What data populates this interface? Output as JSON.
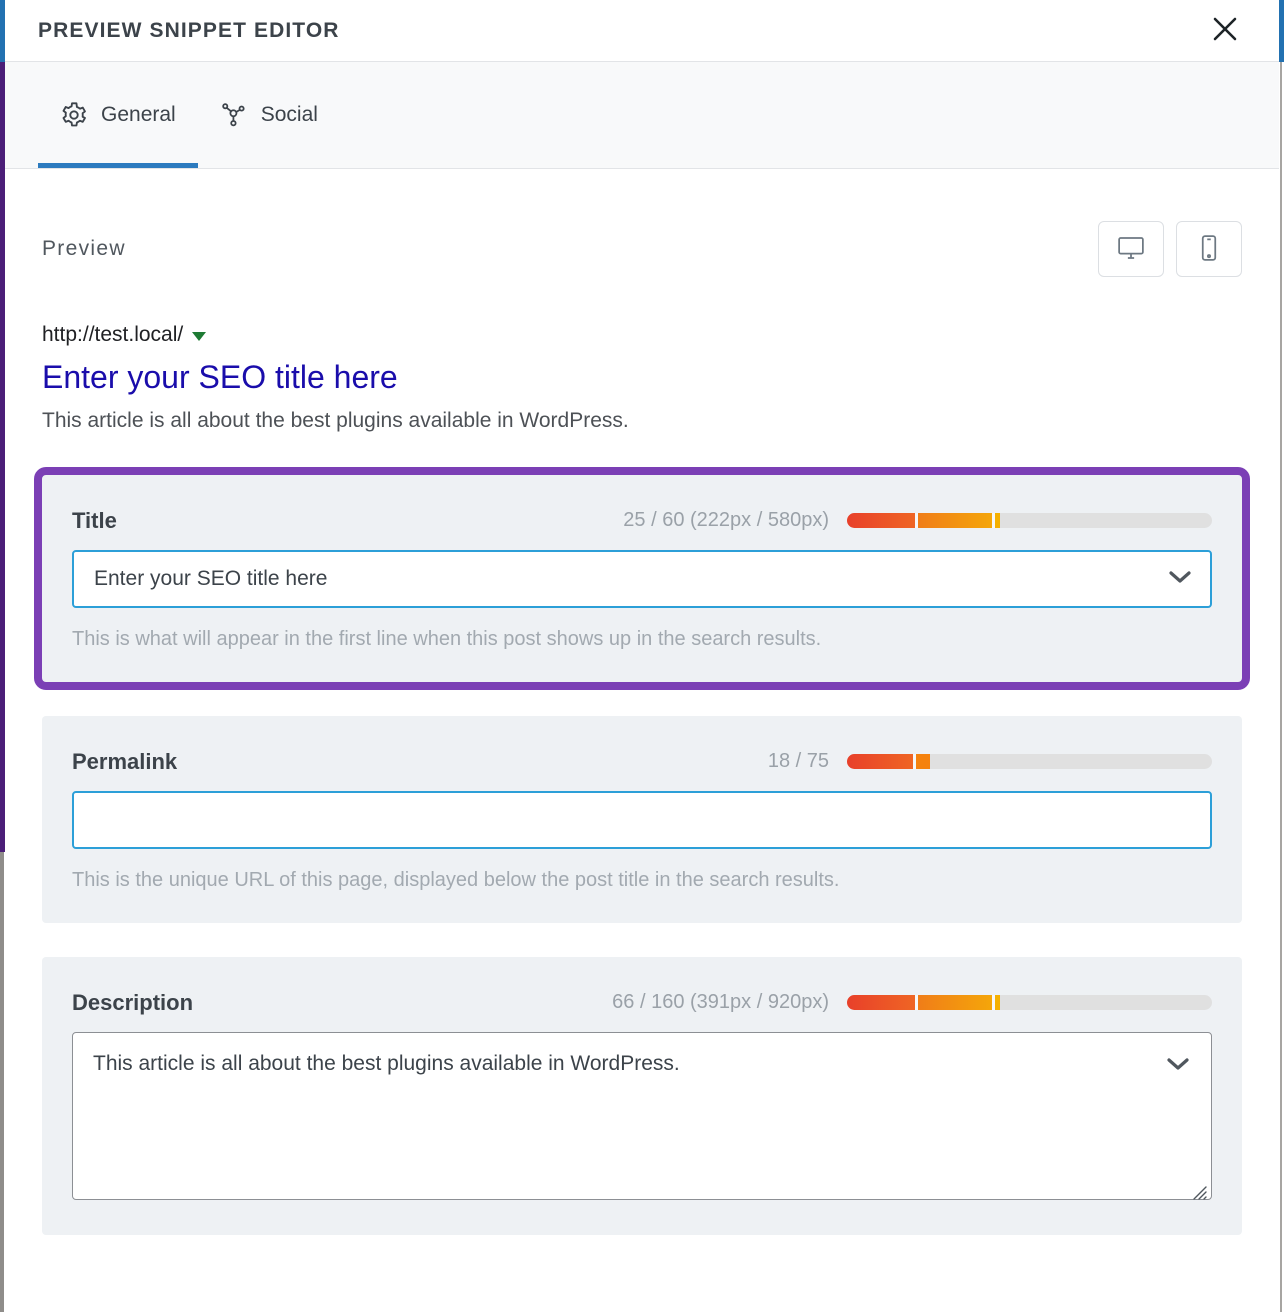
{
  "header": {
    "title": "PREVIEW SNIPPET EDITOR",
    "close_icon": "close-icon"
  },
  "tabs": [
    {
      "label": "General",
      "icon": "gear-icon",
      "active": true
    },
    {
      "label": "Social",
      "icon": "share-nodes-icon",
      "active": false
    }
  ],
  "preview": {
    "label": "Preview",
    "devices": [
      {
        "name": "desktop",
        "icon": "desktop-monitor-icon",
        "active": true
      },
      {
        "name": "mobile",
        "icon": "mobile-phone-icon",
        "active": false
      }
    ],
    "serp": {
      "url": "http://test.local/",
      "caret_icon": "caret-down-icon",
      "title": "Enter your SEO title here",
      "description": "This article is all about the best plugins available in WordPress."
    }
  },
  "fields": [
    {
      "key": "title",
      "label": "Title",
      "counter": "25 / 60 (222px / 580px)",
      "value": "Enter your SEO title here",
      "help": "This is what will appear in the first line when this post shows up in the search results.",
      "highlighted": true,
      "focused": true,
      "has_chevron": true,
      "type": "input",
      "meter": {
        "segments": [
          {
            "width_pct": 18.5,
            "from": "#e8402a",
            "to": "#ef6524"
          },
          {
            "width_pct": 20.5,
            "from": "#f07d18",
            "to": "#f5a60a"
          },
          {
            "width_pct": 1.2,
            "from": "#f5b000",
            "to": "#f5b000"
          }
        ],
        "track_color": "#e0e0e0"
      }
    },
    {
      "key": "permalink",
      "label": "Permalink",
      "counter": "18 / 75",
      "value": "",
      "help": "This is the unique URL of this page, displayed below the post title in the search results.",
      "highlighted": false,
      "focused": true,
      "has_chevron": false,
      "type": "input",
      "meter": {
        "segments": [
          {
            "width_pct": 18.0,
            "from": "#e8402a",
            "to": "#ef6524"
          },
          {
            "width_pct": 4.0,
            "from": "#f5820e",
            "to": "#f5820e"
          }
        ],
        "track_color": "#e0e0e0"
      }
    },
    {
      "key": "description",
      "label": "Description",
      "counter": "66 / 160 (391px / 920px)",
      "value": "This article is all about the best plugins available in WordPress.",
      "help": "",
      "highlighted": false,
      "focused": false,
      "has_chevron": true,
      "type": "textarea",
      "meter": {
        "segments": [
          {
            "width_pct": 18.5,
            "from": "#e8402a",
            "to": "#ef6524"
          },
          {
            "width_pct": 20.5,
            "from": "#f07d18",
            "to": "#f5a60a"
          },
          {
            "width_pct": 1.2,
            "from": "#f5b000",
            "to": "#f5b000"
          }
        ],
        "track_color": "#e0e0e0"
      }
    }
  ],
  "colors": {
    "accent_tab": "#2c7bbf",
    "highlight_outline": "#7b3fb5",
    "focus_border": "#2c9fd8",
    "serp_title": "#1a0dab",
    "serp_caret": "#1e7b34"
  }
}
